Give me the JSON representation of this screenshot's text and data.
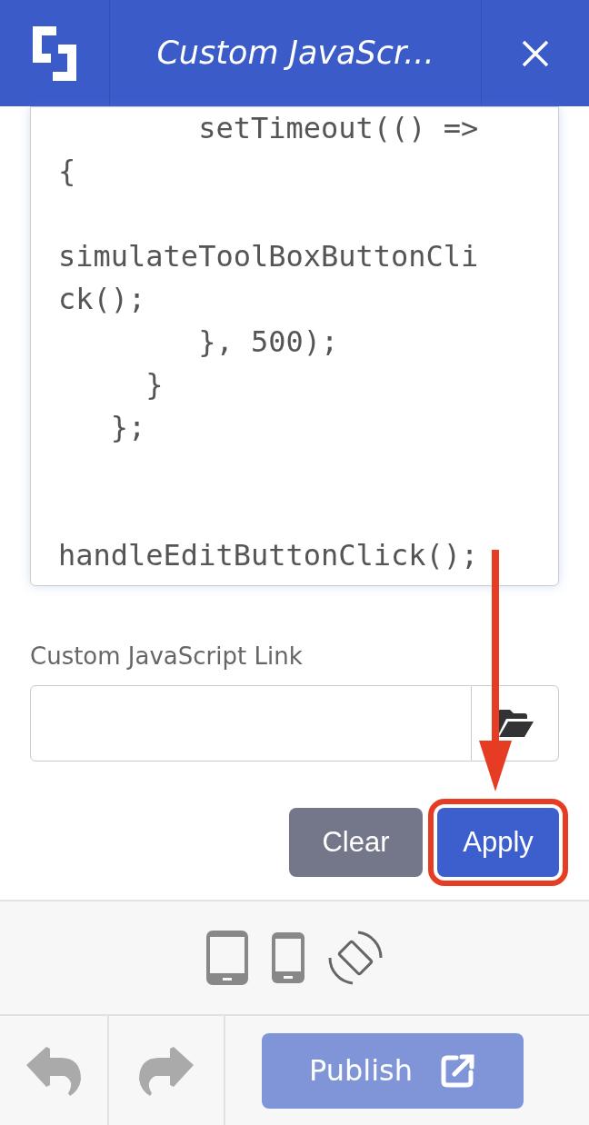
{
  "header": {
    "title": "Custom JavaScr..."
  },
  "code": "        setTimeout(() =>\n{\n\nsimulateToolBoxButtonCli\nck();\n        }, 500);\n     }\n   };\n\n\nhandleEditButtonClick();",
  "link_field": {
    "label": "Custom JavaScript Link"
  },
  "buttons": [
    {
      "label": "Clear",
      "kind": "secondary",
      "highlighted": false
    },
    {
      "label": "Apply",
      "kind": "primary",
      "highlighted": true
    }
  ],
  "devices": [
    {
      "kind": "tablet"
    },
    {
      "kind": "phone"
    },
    {
      "kind": "rotate"
    }
  ],
  "footer": {
    "publish": "Publish"
  }
}
